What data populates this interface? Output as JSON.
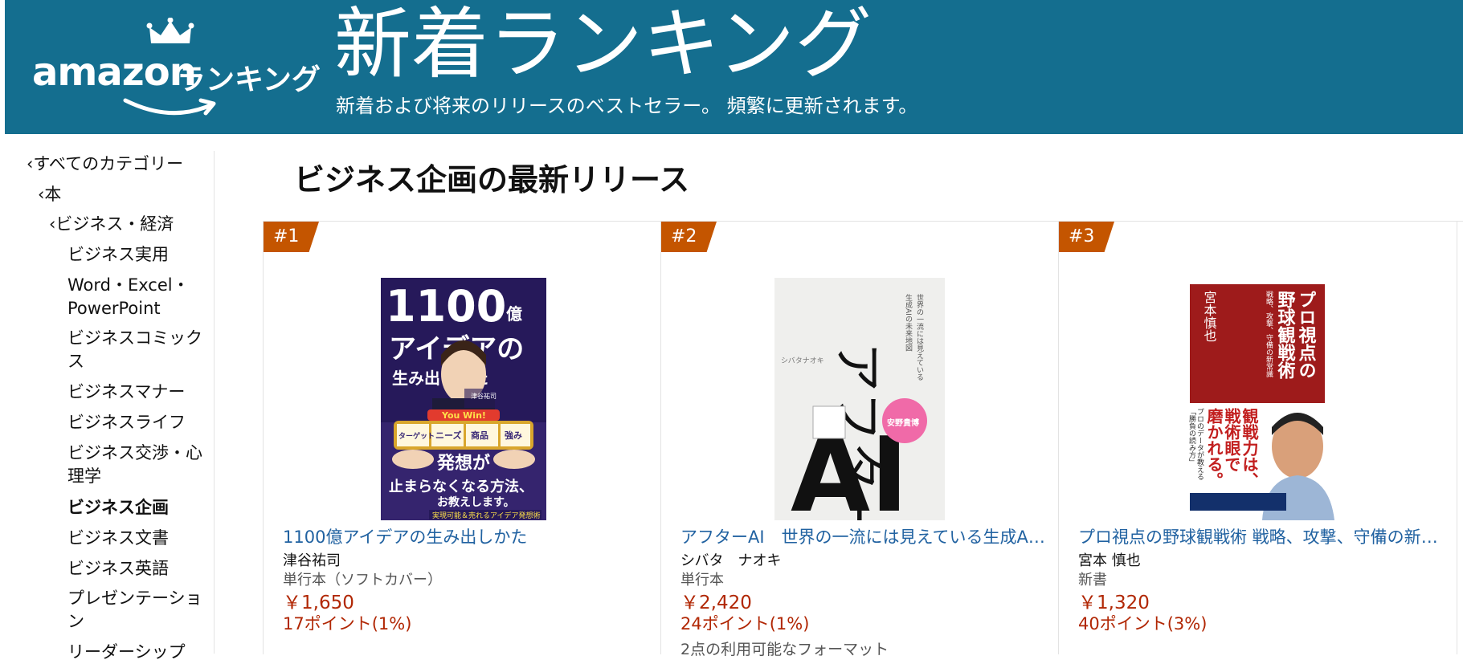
{
  "header": {
    "logo_word": "amazon",
    "logo_sub": "ランキング",
    "title": "新着ランキング",
    "subtitle": "新着および将来のリリースのベストセラー。 頻繁に更新されます。",
    "bg_color": "#146e8f"
  },
  "sidebar": {
    "items": [
      {
        "label": "‹すべてのカテゴリー"
      },
      {
        "label": "‹本"
      },
      {
        "label": "‹ビジネス・経済"
      },
      {
        "label": "ビジネス実用"
      },
      {
        "label": "Word・Excel・PowerPoint"
      },
      {
        "label": "ビジネスコミックス"
      },
      {
        "label": "ビジネスマナー"
      },
      {
        "label": "ビジネスライフ"
      },
      {
        "label": "ビジネス交渉・心理学"
      },
      {
        "label": "ビジネス企画"
      },
      {
        "label": "ビジネス文書"
      },
      {
        "label": "ビジネス英語"
      },
      {
        "label": "プレゼンテーション"
      },
      {
        "label": "リーダーシップ"
      }
    ]
  },
  "main": {
    "title": "ビジネス企画の最新リリース",
    "products": [
      {
        "rank": "#1",
        "title": "1100億アイデアの生み出しかた",
        "author": "津谷祐司",
        "format": "単行本（ソフトカバー）",
        "price": "￥1,650",
        "points": "17ポイント(1%)",
        "formats": "",
        "cover": {
          "t1": "1100",
          "t2": "億",
          "t3": "アイデアの",
          "t4": "生み出しかた",
          "t5": "発想が",
          "t6": "止まらなくなる方法、",
          "t7": "お教えします。",
          "t8": "実現可能＆売れるアイデア発想術",
          "t9": "津谷祐司",
          "t10": "You Win!",
          "reels": [
            "ターゲット",
            "ニーズ",
            "商品",
            "強み"
          ],
          "bg": "#26195a"
        }
      },
      {
        "rank": "#2",
        "title": "アフターAI　世界の一流には見えている生成AIの未来地図",
        "author": "シバタ　ナオキ",
        "format": "単行本",
        "price": "￥2,420",
        "points": "24ポイント(1%)",
        "formats": "2点の利用可能なフォーマット",
        "cover": {
          "t1": "アフター",
          "t2": "AI",
          "t3": "世界の一流には見えている",
          "t4": "生成AIの未来地図",
          "t5": "シバタナオキ",
          "t6": "安野貴博",
          "bg": "#efefed"
        }
      },
      {
        "rank": "#3",
        "title": "プロ視点の野球観戦術 戦略、攻撃、守備の新常識",
        "author": "宮本 慎也",
        "format": "新書",
        "price": "￥1,320",
        "points": "40ポイント(3%)",
        "formats": "",
        "cover": {
          "t1": "プロ視点の",
          "t2": "野球観戦術",
          "t3": "戦略、攻撃、守備の新常識",
          "t4": "宮本慎也",
          "t5": "観戦力は、",
          "t6": "戦術眼で",
          "t7": "磨かれる。",
          "t8": "プロのデータが教える",
          "t9": "「勝負の読み方」",
          "band_color": "#9e1b1b"
        }
      }
    ]
  }
}
